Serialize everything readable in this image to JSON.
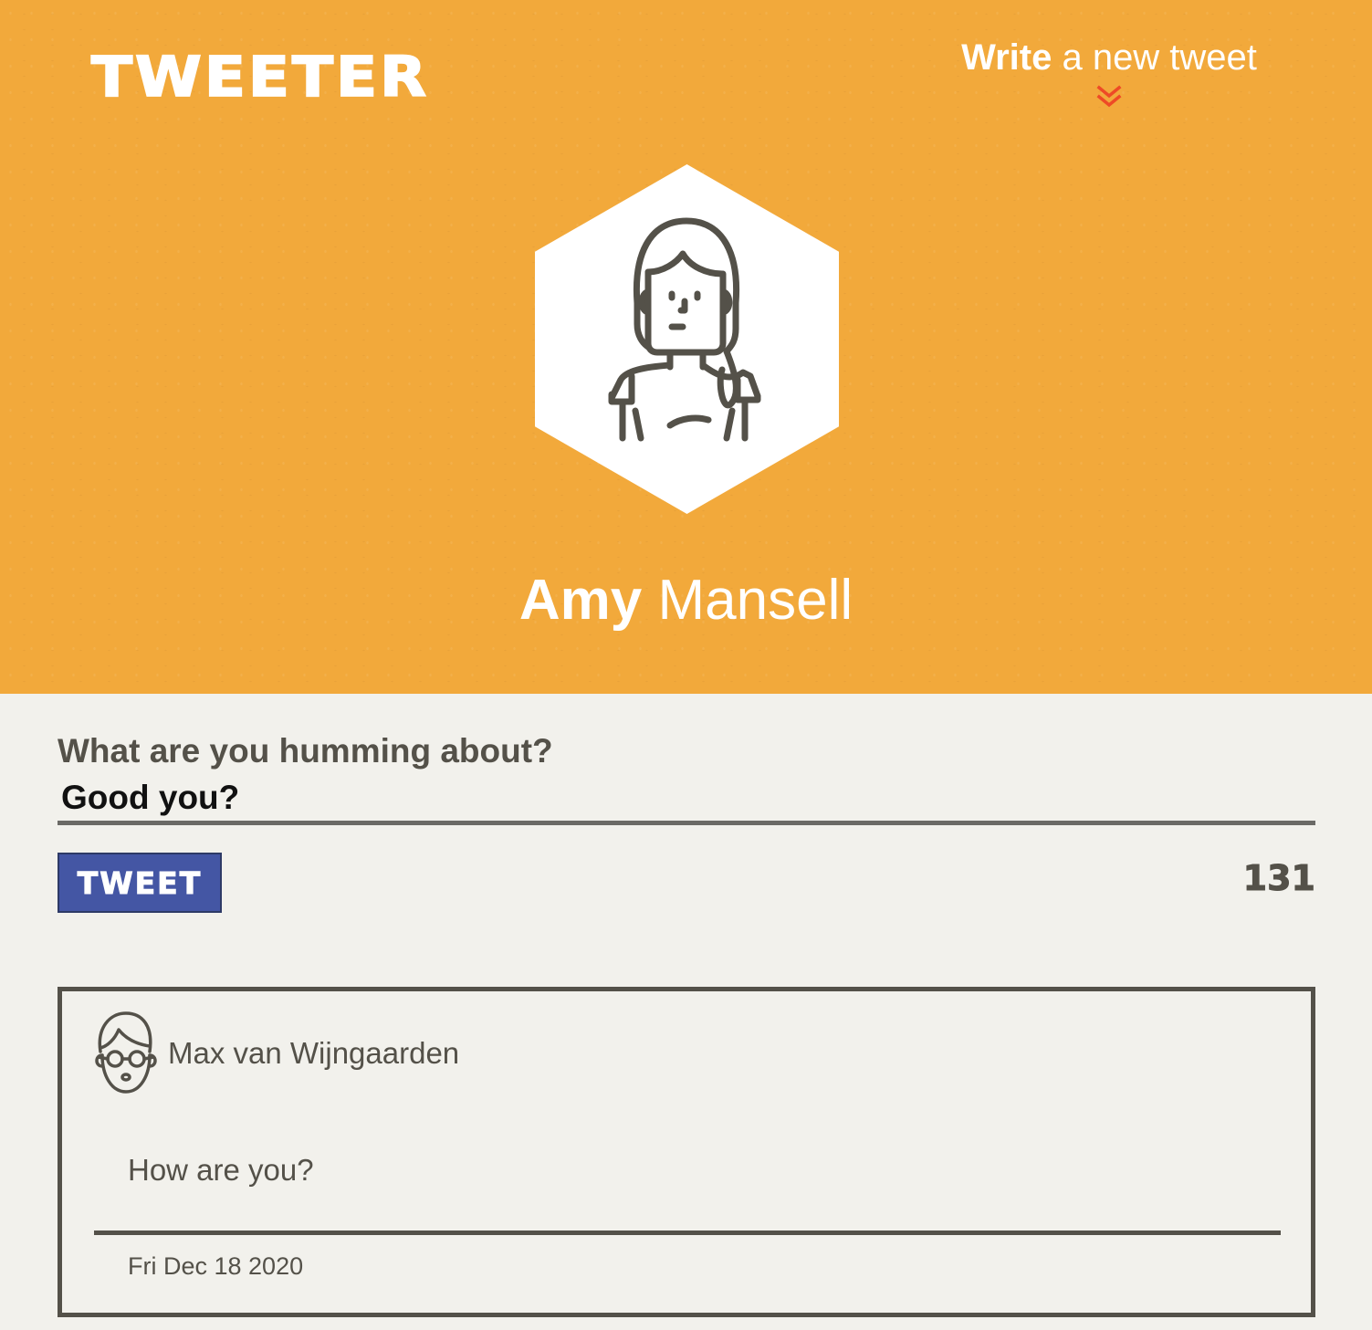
{
  "app": {
    "logo_text": "TWEETER",
    "compose_toggle": {
      "strong": "Write",
      "rest": " a new tweet",
      "icon": "double-chevron-down-icon",
      "icon_color": "#ee4a26"
    }
  },
  "profile": {
    "first_name": "Amy",
    "last_name": " Mansell",
    "avatar_icon": "woman-avatar-icon"
  },
  "compose": {
    "label": "What are you humming about?",
    "input_value": "Good you?",
    "button_label": "TWEET",
    "counter": "131"
  },
  "tweets": [
    {
      "author": "Max van Wijngaarden",
      "avatar_icon": "man-with-glasses-avatar-icon",
      "text": "How are you?",
      "date": "Fri Dec 18 2020"
    }
  ],
  "colors": {
    "header_bg": "#f2a93b",
    "page_bg": "#f2f1ec",
    "text_dark": "#545149",
    "button_bg": "#4456a4",
    "accent_red": "#ee4a26"
  }
}
